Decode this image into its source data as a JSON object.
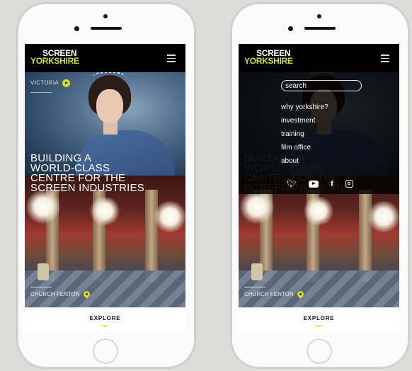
{
  "brand": {
    "line1": "SCREEN",
    "line2": "YORKSHIRE",
    "accent": "#d4dd25"
  },
  "hero": {
    "feature_label": "VICTORIA",
    "headline_lines": [
      "BUILDING A",
      "WORLD-CLASS",
      "CENTRE FOR THE",
      "SCREEN INDUSTRIES"
    ],
    "location": "CHURCH FENTON"
  },
  "footer": {
    "explore_label": "EXPLORE"
  },
  "menu": {
    "search_placeholder": "search",
    "items": [
      "why yorkshire?",
      "investment",
      "training",
      "film office",
      "about"
    ],
    "socials": [
      "twitter-icon",
      "youtube-icon",
      "facebook-icon",
      "instagram-icon"
    ]
  }
}
